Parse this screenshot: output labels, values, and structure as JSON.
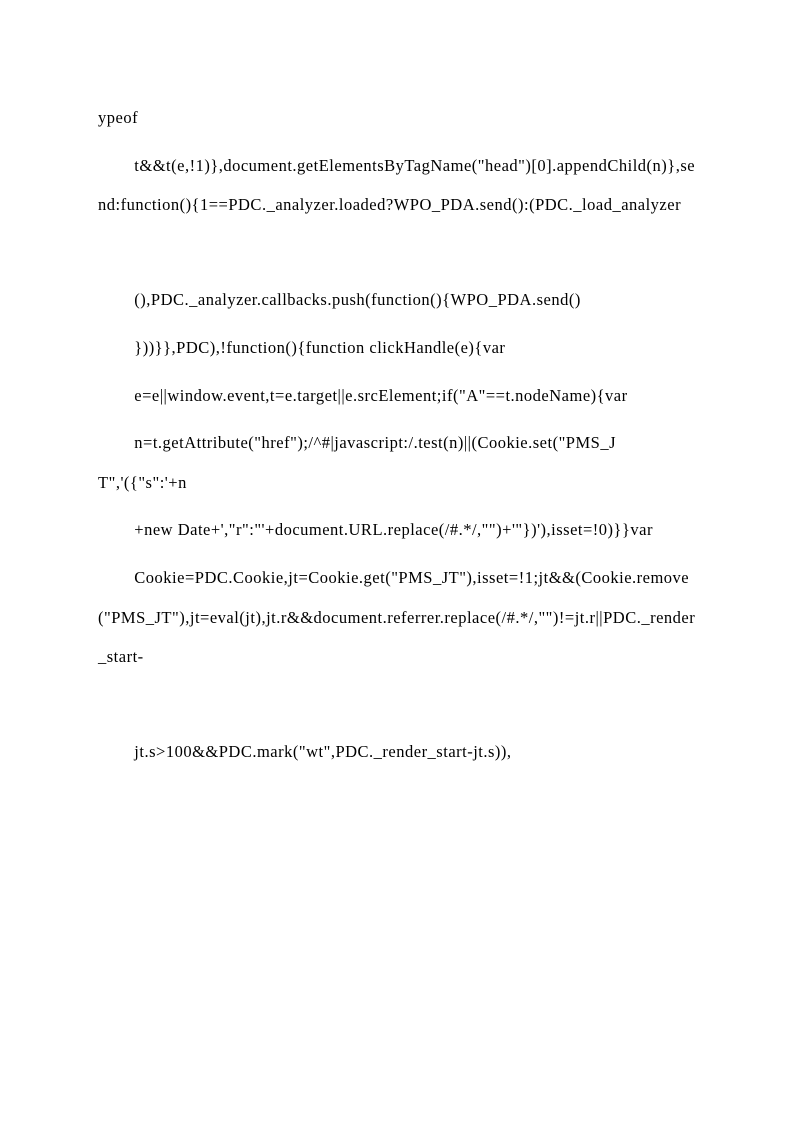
{
  "paragraphs": [
    {
      "indent": false,
      "text": "ypeof"
    },
    {
      "indent": true,
      "text": "t&&t(e,!1)},document.getElementsByTagName(\"head\")[0].appendChild(n)},send:function(){1==PDC._analyzer.loaded?WPO_PDA.send():(PDC._load_analyzer"
    },
    {
      "indent": false,
      "text": ""
    },
    {
      "indent": true,
      "text": "(),PDC._analyzer.callbacks.push(function(){WPO_PDA.send()"
    },
    {
      "indent": true,
      "text": "}))}},PDC),!function(){function clickHandle(e){var"
    },
    {
      "indent": true,
      "text": "e=e||window.event,t=e.target||e.srcElement;if(\"A\"==t.nodeName){var"
    },
    {
      "indent": true,
      "text": "n=t.getAttribute(\"href\");/^#|javascript:/.test(n)||(Cookie.set(\"PMS_JT\",'({\"s\":'+n"
    },
    {
      "indent": true,
      "text": "+new Date+',\"r\":\"'+document.URL.replace(/#.*/,\"\")+'\"})'),isset=!0)}}var"
    },
    {
      "indent": true,
      "text": "Cookie=PDC.Cookie,jt=Cookie.get(\"PMS_JT\"),isset=!1;jt&&(Cookie.remove(\"PMS_JT\"),jt=eval(jt),jt.r&&document.referrer.replace(/#.*/,\"\")!=jt.r||PDC._render_start-"
    },
    {
      "indent": false,
      "text": ""
    },
    {
      "indent": true,
      "text": "jt.s>100&&PDC.mark(\"wt\",PDC._render_start-jt.s)),"
    }
  ]
}
